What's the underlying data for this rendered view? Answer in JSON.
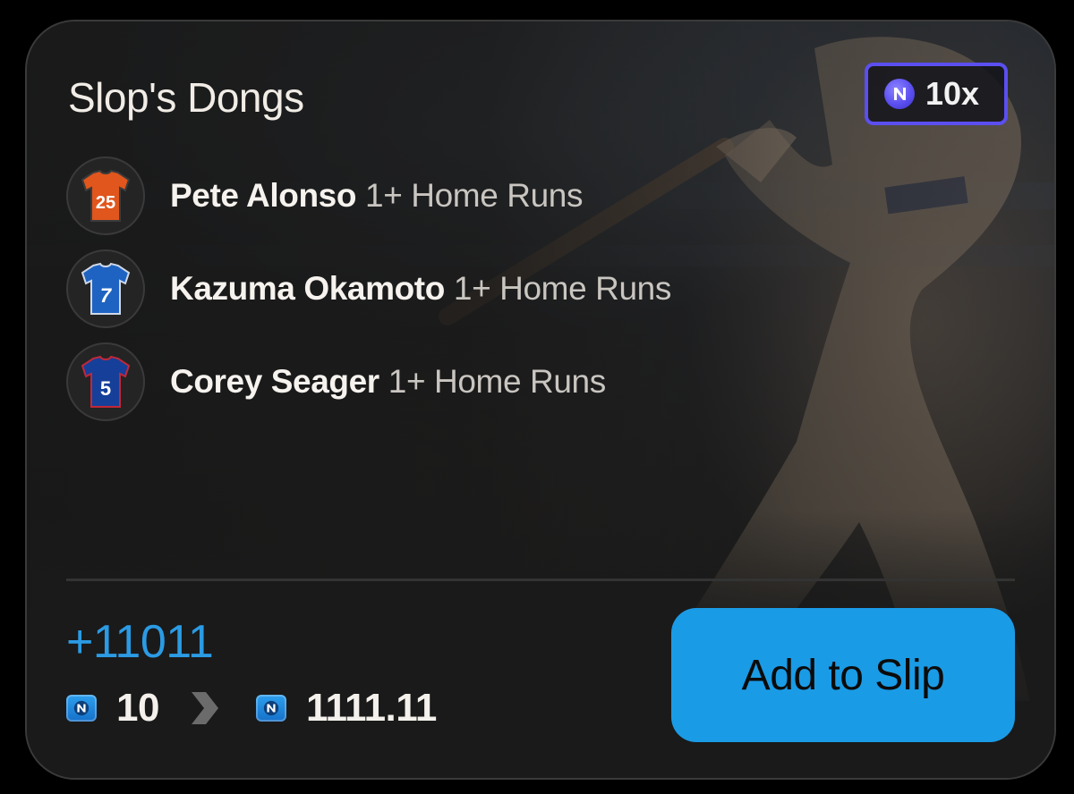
{
  "card": {
    "title": "Slop's Dongs",
    "multiplier": "10x",
    "legs": [
      {
        "player": "Pete Alonso",
        "market": "1+ Home Runs",
        "jersey_number": "25",
        "jersey_color": "#e0561c",
        "jersey_trim": "#3b3b3b"
      },
      {
        "player": "Kazuma Okamoto",
        "market": "1+ Home Runs",
        "jersey_number": "7",
        "jersey_color": "#1f63c2",
        "jersey_trim": "#cfd8e6"
      },
      {
        "player": "Corey Seager",
        "market": "1+ Home Runs",
        "jersey_number": "5",
        "jersey_color": "#163f99",
        "jersey_trim": "#c0283a"
      }
    ],
    "odds": "+11011",
    "stake": "10",
    "payout": "1111.11",
    "button_label": "Add to Slip"
  },
  "colors": {
    "accent_blue": "#1a9be6",
    "odds_blue": "#2b9be4",
    "multiplier_border": "#5b4ff0"
  }
}
